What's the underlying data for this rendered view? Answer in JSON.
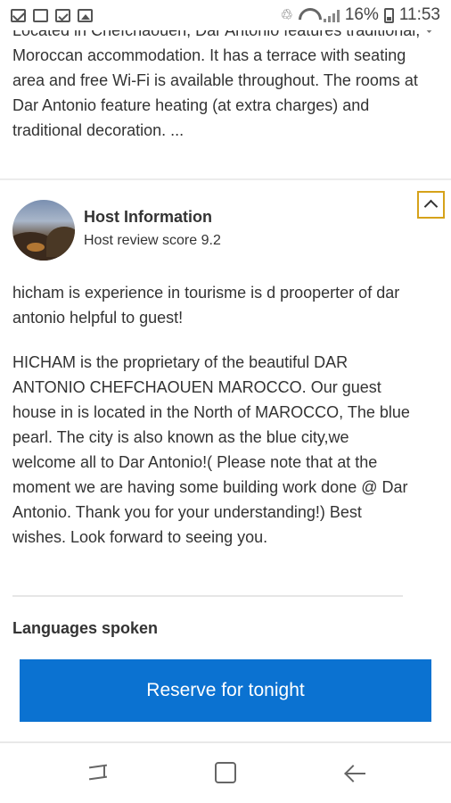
{
  "status_bar": {
    "battery": "16%",
    "time": "11:53",
    "icons": [
      "mail-icon",
      "voicemail-icon",
      "checklist-icon",
      "image-icon",
      "recycle-icon",
      "wifi-icon",
      "signal-icon",
      "battery-icon"
    ]
  },
  "description": {
    "text": "Located in Chefchaouen, Dar Antonio features traditional, Moroccan accommodation. It has a terrace with seating area and free Wi-Fi is available throughout. The rooms at Dar Antonio feature heating (at extra charges) and traditional decoration. ..."
  },
  "host": {
    "title": "Host Information",
    "score": "Host review score 9.2",
    "summary": "hicham is experience in tourisme is d prooperter of dar antonio helpful to guest!",
    "bio": "HICHAM is the proprietary of the beautiful DAR ANTONIO CHEFCHAOUEN MAROCCO. Our guest house in is located in the North of MAROCCO, The blue pearl. The city is also known as the blue city,we welcome all to Dar Antonio!( Please note that at the moment we are having some building work done @ Dar Antonio. Thank you for your understanding!) Best wishes. Look forward to seeing you."
  },
  "languages": {
    "title": "Languages spoken"
  },
  "actions": {
    "reserve_label": "Reserve for tonight"
  },
  "colors": {
    "accent": "#0b72d1",
    "collapse_border": "#d6a21a"
  }
}
